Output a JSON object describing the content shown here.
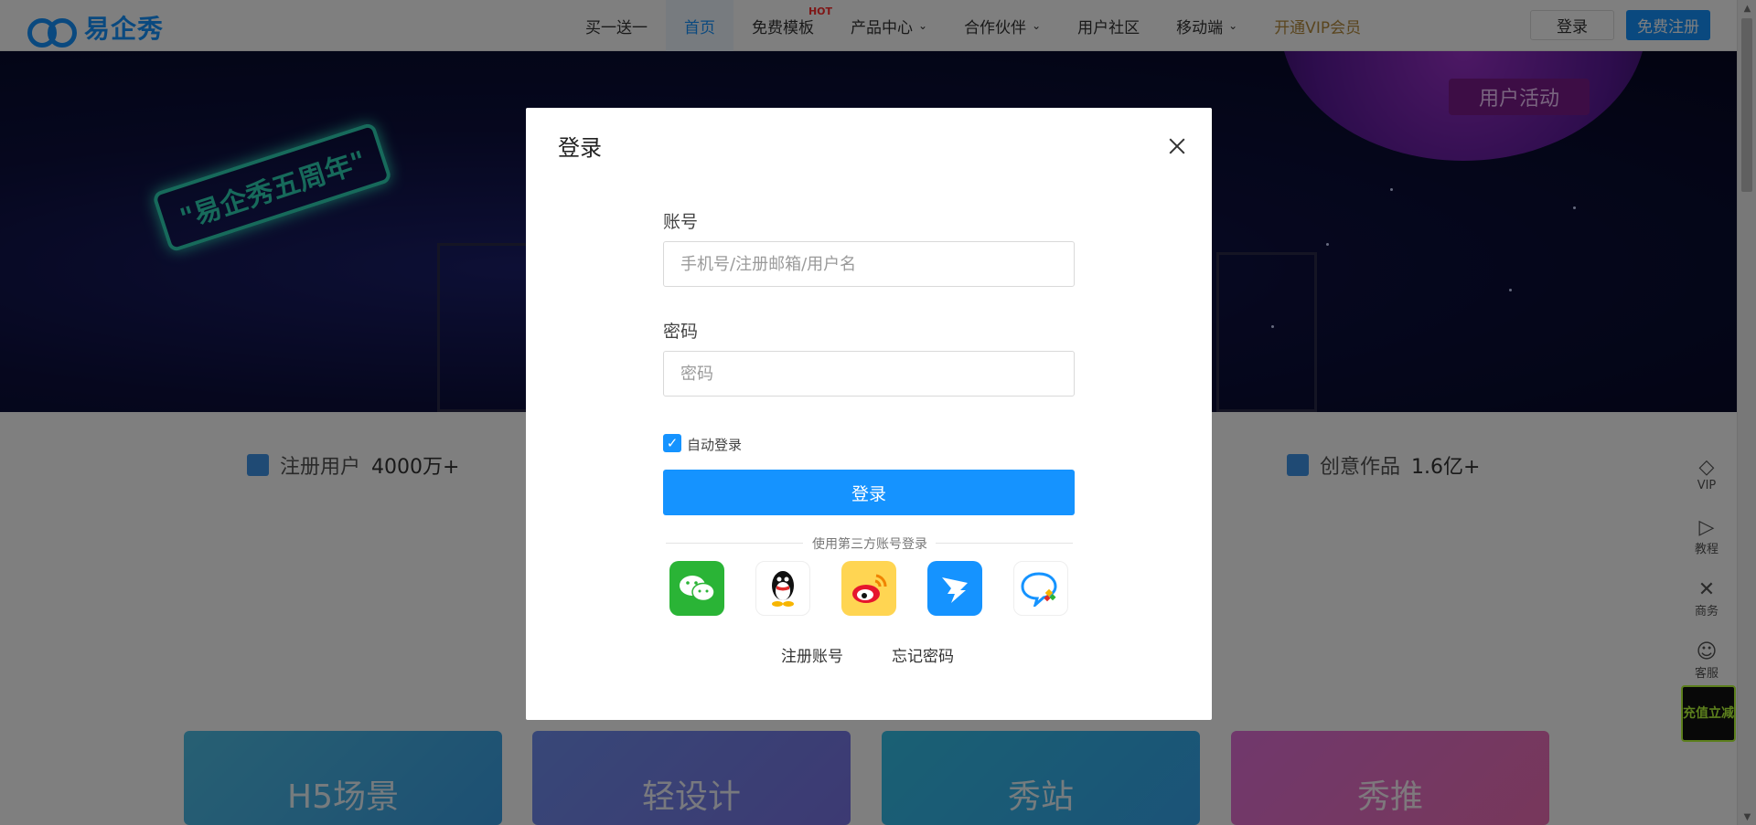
{
  "nav": {
    "logo_text": "易企秀",
    "items": [
      {
        "label": "买一送一",
        "active": false
      },
      {
        "label": "首页",
        "active": true
      },
      {
        "label": "免费模板",
        "badge": "HOT"
      },
      {
        "label": "产品中心",
        "caret": true
      },
      {
        "label": "合作伙伴",
        "caret": true
      },
      {
        "label": "用户社区"
      },
      {
        "label": "移动端",
        "caret": true
      },
      {
        "label": "开通VIP会员"
      }
    ],
    "login_label": "登录",
    "register_label": "免费注册"
  },
  "banner": {
    "sign_text": "\"易企秀五周年\"",
    "activity_label": "用户活动"
  },
  "stats": [
    {
      "label": "注册用户",
      "value": "4000万+"
    },
    {
      "label": "创意作品",
      "value": "1.6亿+"
    }
  ],
  "products": [
    "H5场景",
    "轻设计",
    "秀站",
    "秀推"
  ],
  "side_tools": [
    {
      "label": "VIP",
      "icon": "diamond-icon"
    },
    {
      "label": "教程",
      "icon": "play-icon"
    },
    {
      "label": "商务",
      "icon": "handshake-icon"
    },
    {
      "label": "客服",
      "icon": "person-icon"
    }
  ],
  "recharge_label": "充值立减",
  "modal": {
    "title": "登录",
    "account_label": "账号",
    "account_placeholder": "手机号/注册邮箱/用户名",
    "password_label": "密码",
    "password_placeholder": "密码",
    "auto_login_label": "自动登录",
    "auto_login_checked": true,
    "login_button": "登录",
    "third_party_text": "使用第三方账号登录",
    "social_logins": [
      "wechat",
      "qq",
      "weibo",
      "dingtalk",
      "other"
    ],
    "register_link": "注册账号",
    "forgot_link": "忘记密码"
  },
  "colors": {
    "brand": "#1593ff",
    "hot": "#ff2d2d",
    "wechat": "#2ab436",
    "weibo": "#ffd552"
  }
}
